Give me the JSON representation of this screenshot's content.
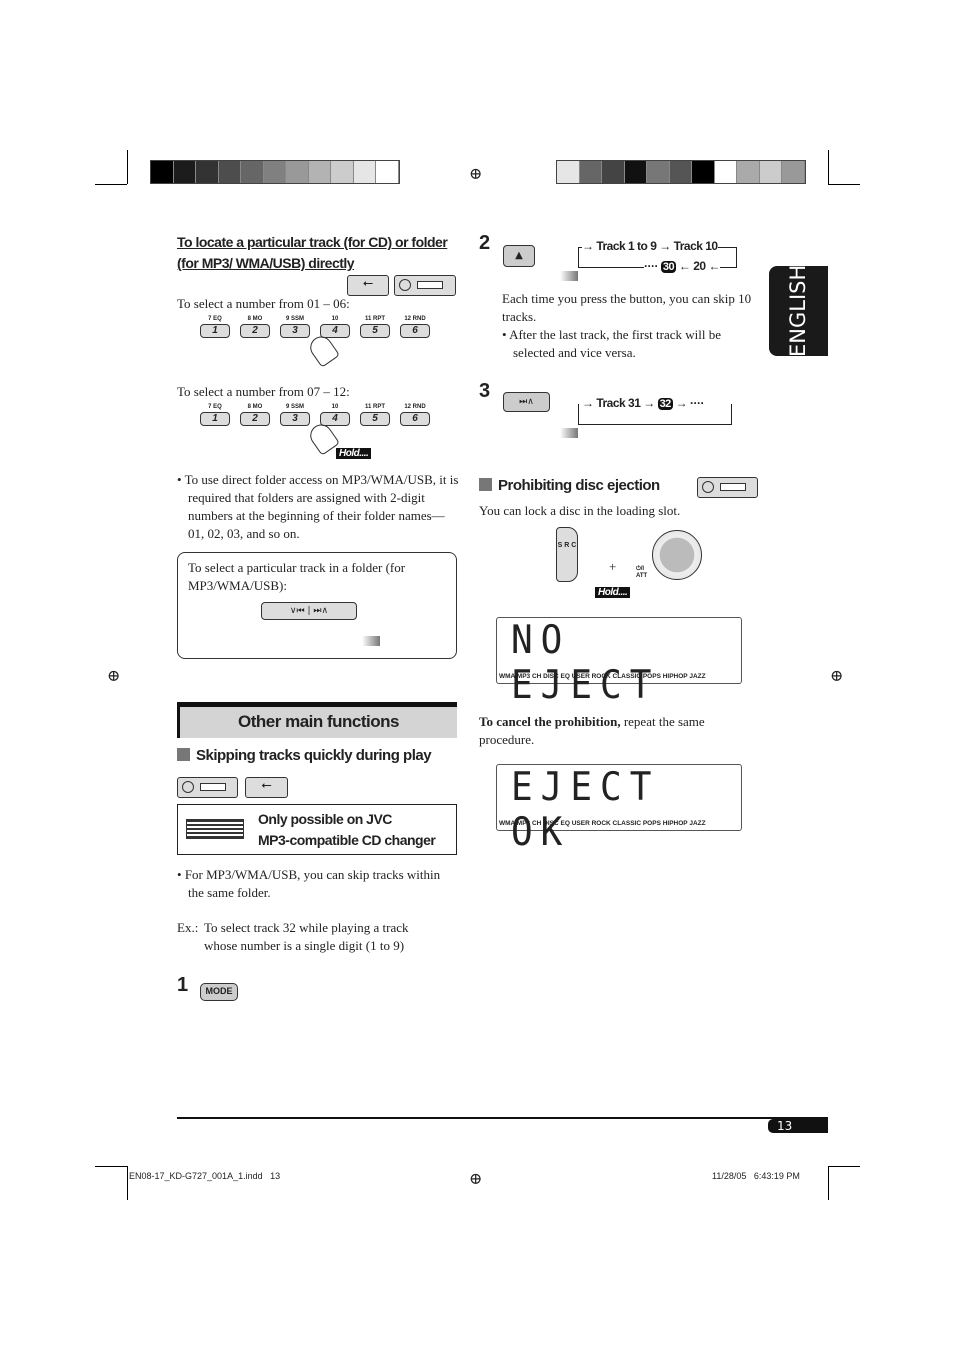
{
  "colorbars": {
    "left": [
      "#000000",
      "#1c1c1c",
      "#333333",
      "#4d4d4d",
      "#666666",
      "#808080",
      "#999999",
      "#b3b3b3",
      "#cccccc",
      "#e6e6e6",
      "#ffffff"
    ],
    "right": [
      "#e6e6e6",
      "#666666",
      "#444444",
      "#111111",
      "#777777",
      "#555555",
      "#000000",
      "#ffffff",
      "#aaaaaa",
      "#cccccc",
      "#999999"
    ]
  },
  "left": {
    "heading_line1": "To locate a particular track (for CD) or folder",
    "heading_line2": "(for MP3/ WMA/USB) directly",
    "select_0106": "To select a number from 01 – 06:",
    "select_0712": "To select a number from 07 – 12:",
    "keys": [
      {
        "top": "7  EQ",
        "num": "1"
      },
      {
        "top": "8  MO",
        "num": "2"
      },
      {
        "top": "9  SSM",
        "num": "3"
      },
      {
        "top": "10",
        "num": "4"
      },
      {
        "top": "11  RPT",
        "num": "5"
      },
      {
        "top": "12  RND",
        "num": "6"
      }
    ],
    "hold": "Hold....",
    "bullet_folder": "To use direct folder access on MP3/WMA/USB, it is required that folders are assigned with 2-digit numbers at the beginning of their folder names—01, 02, 03, and so on.",
    "box_text": "To select a particular track in a folder (for MP3/WMA/USB):",
    "section_title": "Other main functions",
    "skip_heading": "Skipping tracks quickly during play",
    "jvc_note_line1": "Only possible on JVC",
    "jvc_note_line2": "MP3-compatible CD changer",
    "bullet_skip": "For MP3/WMA/USB, you can skip tracks within the same folder.",
    "ex_label": "Ex.:",
    "ex_text": "To select track 32 while playing a track whose number is a single digit (1 to 9)",
    "step1": "1",
    "mode_button": "MODE"
  },
  "right": {
    "step2": "2",
    "flow2": {
      "a": "Track 1 to 9",
      "b": "Track 10",
      "c": "20",
      "d": "30",
      "dots": "····"
    },
    "para2": "Each time you press the button, you can skip 10 tracks.",
    "bullet2": "After the last track, the first track will be selected and vice versa.",
    "step3": "3",
    "flow3": {
      "a": "Track 31",
      "b": "32",
      "dots": "····"
    },
    "prohibit_heading": "Prohibiting disc ejection",
    "prohibit_text": "You can lock a disc in the loading slot.",
    "src_label": "S R C",
    "plus": "+",
    "att_label": "⏻/I ATT",
    "hold": "Hold....",
    "lcd1": "NO EJECT",
    "lcd2": "EJECT OK",
    "lcd_labels": "WMA  MP3   CH   DISC  EQ  USER ROCK CLASSIC POPS HIPHOP JAZZ",
    "cancel_bold": "To cancel the prohibition,",
    "cancel_rest": " repeat the same procedure."
  },
  "side_tab": "ENGLISH",
  "page_number": "13",
  "footer": {
    "file": "EN08-17_KD-G727_001A_1.indd   13",
    "date": "11/28/05   6:43:19 PM"
  }
}
